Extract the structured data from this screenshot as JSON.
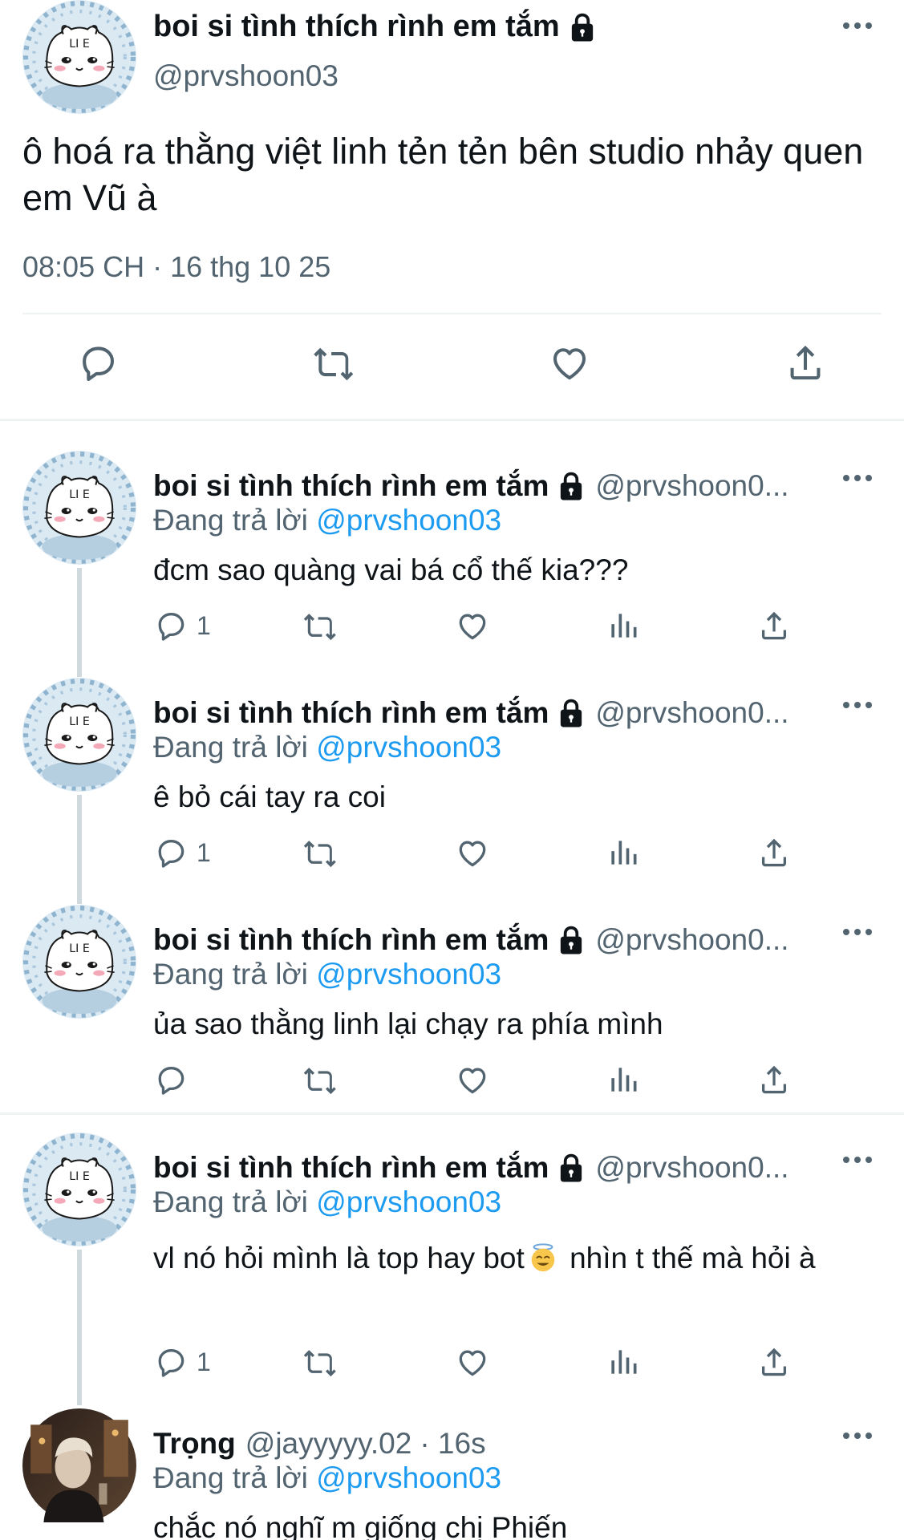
{
  "main_tweet": {
    "author_name": "boi si tình thích rình em tắm",
    "author_handle": "@prvshoon03",
    "text": "ô hoá ra thằng việt linh tẻn tẻn bên studio nhảy quen em Vũ à",
    "timestamp": "08:05 CH · 16 thg 10 25",
    "icons": [
      "reply-icon",
      "retweet-icon",
      "like-icon",
      "share-icon"
    ]
  },
  "replies": [
    {
      "author_name": "boi si tình thích rình em tắm",
      "author_handle": "@prvshoon0...",
      "replying_prefix": "Đang trả lời",
      "replying_to": "@prvshoon03",
      "text": "đcm sao quàng vai bá cổ thế kia???",
      "reply_count": "1"
    },
    {
      "author_name": "boi si tình thích rình em tắm",
      "author_handle": "@prvshoon0...",
      "replying_prefix": "Đang trả lời",
      "replying_to": "@prvshoon03",
      "text": "ê bỏ cái tay ra coi",
      "reply_count": "1"
    },
    {
      "author_name": "boi si tình thích rình em tắm",
      "author_handle": "@prvshoon0...",
      "replying_prefix": "Đang trả lời",
      "replying_to": "@prvshoon03",
      "text": "ủa sao thằng linh lại chạy ra phía mình",
      "reply_count": ""
    },
    {
      "author_name": "boi si tình thích rình em tắm",
      "author_handle": "@prvshoon0...",
      "replying_prefix": "Đang trả lời",
      "replying_to": "@prvshoon03",
      "text_before_emoji": "vl nó hỏi mình là top hay bot",
      "emoji": "smiling-face-with-halo-emoji",
      "text_after_emoji": " nhìn t thế mà hỏi à",
      "reply_count": "1"
    },
    {
      "author_name": "Trọng",
      "author_handle": "@jayyyyy.02",
      "time": "· 16s",
      "replying_prefix": "Đang trả lời",
      "replying_to": "@prvshoon03",
      "text": "chắc nó nghĩ m giống chị Phiến"
    }
  ],
  "colors": {
    "text": "#0f1419",
    "secondary": "#536471",
    "link": "#1d9bf0",
    "divider": "#eff3f4",
    "thread_line": "#cfd9de"
  }
}
